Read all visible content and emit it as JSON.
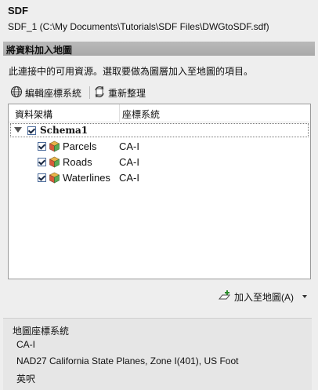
{
  "header": {
    "title": "SDF",
    "subtitle": "SDF_1 (C:\\My Documents\\Tutorials\\SDF Files\\DWGtoSDF.sdf)"
  },
  "section": {
    "title": "將資料加入地圖",
    "instruction": "此連接中的可用資源。選取要做為圖層加入至地圖的項目。"
  },
  "toolbar": {
    "edit_cs_label": "編輯座標系統",
    "refresh_label": "重新整理"
  },
  "tree": {
    "columns": [
      "資料架構",
      "座標系統"
    ],
    "schema": {
      "label": "Schema1",
      "checked": true,
      "expanded": true
    },
    "features": [
      {
        "name": "Parcels",
        "cs": "CA-I",
        "checked": true
      },
      {
        "name": "Roads",
        "cs": "CA-I",
        "checked": true
      },
      {
        "name": "Waterlines",
        "cs": "CA-I",
        "checked": true
      }
    ]
  },
  "add_to_map": {
    "label": "加入至地圖(A)"
  },
  "map_cs": {
    "label": "地圖座標系統",
    "code": "CA-I",
    "name": "NAD27 California State Planes, Zone I(401), US Foot",
    "units": "英呎"
  }
}
